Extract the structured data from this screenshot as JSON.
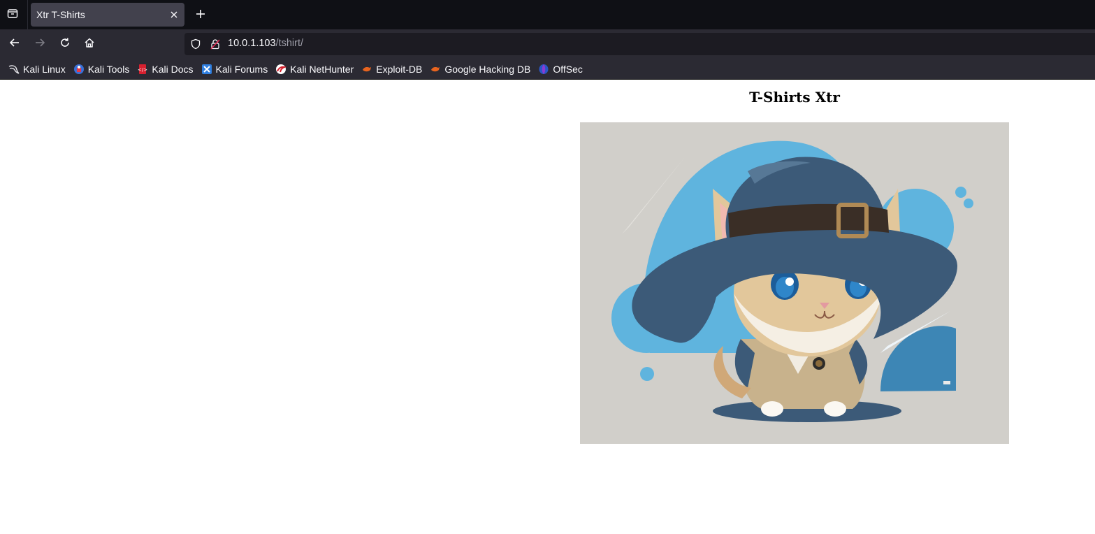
{
  "browser": {
    "tab": {
      "title": "Xtr T-Shirts"
    },
    "url": {
      "host": "10.0.1.103",
      "path": "/tshirt/"
    },
    "bookmarks": [
      {
        "label": "Kali Linux",
        "icon": "kali-dragon-icon"
      },
      {
        "label": "Kali Tools",
        "icon": "kali-tools-icon"
      },
      {
        "label": "Kali Docs",
        "icon": "kali-docs-icon"
      },
      {
        "label": "Kali Forums",
        "icon": "kali-forums-icon"
      },
      {
        "label": "Kali NetHunter",
        "icon": "kali-nethunter-icon"
      },
      {
        "label": "Exploit-DB",
        "icon": "exploit-db-icon"
      },
      {
        "label": "Google Hacking DB",
        "icon": "ghdb-icon"
      },
      {
        "label": "OffSec",
        "icon": "offsec-icon"
      }
    ]
  },
  "page": {
    "title": "T-Shirts Xtr",
    "image": {
      "subject": "cartoon kitten wearing a blue wide-brim hat and trench coat"
    }
  },
  "colors": {
    "tabstrip_bg": "#0f1015",
    "toolbar_bg": "#2b2a33",
    "active_tab_bg": "#42414d",
    "urlbar_bg": "#1c1b22",
    "image_bg": "#d1cfca",
    "accent_blue": "#5fb4de",
    "hat_navy": "#3c5a78"
  }
}
